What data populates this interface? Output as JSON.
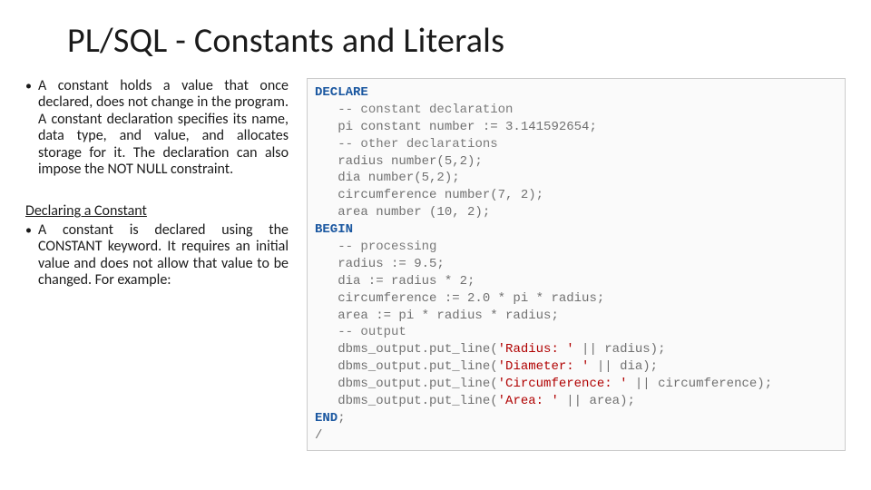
{
  "title": "PL/SQL - Constants and Literals",
  "p1": "A constant holds a value that once declared, does not change in the program. A constant declaration specifies its name, data type, and value, and allocates storage for it. The declaration can also impose the NOT NULL constraint.",
  "subhead": "Declaring a Constant",
  "p2": "A constant is declared using the CONSTANT keyword. It requires an initial value and does not allow that value to be changed. For example:",
  "code": {
    "kw_declare": "DECLARE",
    "c1": "-- constant declaration",
    "l_pi": "   pi constant number := 3.141592654;",
    "c2": "-- other declarations",
    "l_radius": "   radius number(5,2);",
    "l_dia": "   dia number(5,2);",
    "l_circ": "   circumference number(7, 2);",
    "l_area": "   area number (10, 2);",
    "kw_begin": "BEGIN",
    "c3": "-- processing",
    "s_radius": "   radius := 9.5;",
    "s_dia": "   dia := radius * 2;",
    "s_circ": "   circumference := 2.0 * pi * radius;",
    "s_area": "   area := pi * radius * radius;",
    "c4": "-- output",
    "o1a": "   dbms_output.put_line(",
    "o1s": "'Radius: '",
    "o1b": " || radius);",
    "o2a": "   dbms_output.put_line(",
    "o2s": "'Diameter: '",
    "o2b": " || dia);",
    "o3a": "   dbms_output.put_line(",
    "o3s": "'Circumference: '",
    "o3b": " || circumference);",
    "o4a": "   dbms_output.put_line(",
    "o4s": "'Area: '",
    "o4b": " || area);",
    "kw_end": "END",
    "semi": ";",
    "slash": "/"
  }
}
